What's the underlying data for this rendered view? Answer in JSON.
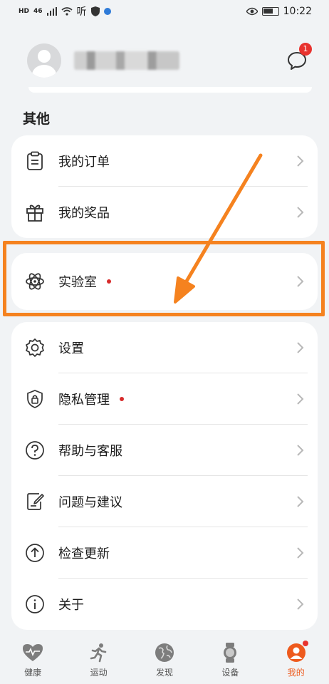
{
  "status_bar": {
    "left_tags": [
      "HD",
      "46",
      "听"
    ],
    "time": "10:22"
  },
  "profile": {
    "notification_count": "1"
  },
  "section": {
    "title": "其他"
  },
  "groups": [
    {
      "items": [
        {
          "label": "我的订单",
          "icon": "clipboard-icon",
          "dot": false
        },
        {
          "label": "我的奖品",
          "icon": "gift-icon",
          "dot": false
        }
      ]
    },
    {
      "items": [
        {
          "label": "实验室",
          "icon": "atom-icon",
          "dot": true
        }
      ]
    },
    {
      "items": [
        {
          "label": "设置",
          "icon": "gear-icon",
          "dot": false
        },
        {
          "label": "隐私管理",
          "icon": "lock-shield-icon",
          "dot": true
        },
        {
          "label": "帮助与客服",
          "icon": "help-icon",
          "dot": false
        },
        {
          "label": "问题与建议",
          "icon": "edit-note-icon",
          "dot": false
        },
        {
          "label": "检查更新",
          "icon": "upload-circle-icon",
          "dot": false
        },
        {
          "label": "关于",
          "icon": "info-icon",
          "dot": false
        }
      ]
    }
  ],
  "bottom_nav": [
    {
      "label": "健康",
      "icon": "heart-pulse-icon",
      "active": false
    },
    {
      "label": "运动",
      "icon": "runner-icon",
      "active": false
    },
    {
      "label": "发现",
      "icon": "globe-icon",
      "active": false
    },
    {
      "label": "设备",
      "icon": "watch-icon",
      "active": false
    },
    {
      "label": "我的",
      "icon": "user-icon",
      "active": true
    }
  ],
  "colors": {
    "background": "#f1f3f5",
    "accent": "#ee5a1d",
    "highlight": "#f5821f",
    "badge": "#e8322e"
  }
}
